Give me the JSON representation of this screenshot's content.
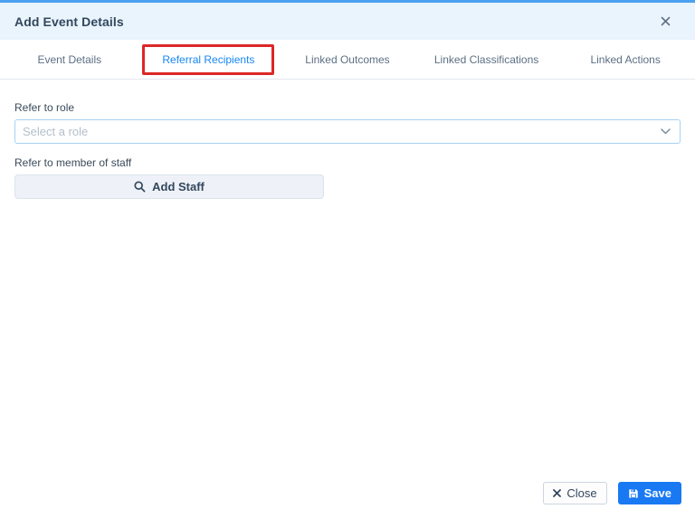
{
  "modal": {
    "title": "Add Event Details"
  },
  "tabs": [
    {
      "label": "Event Details",
      "active": false
    },
    {
      "label": "Referral Recipients",
      "active": true,
      "annotated": true,
      "annotation_color": "#dd2727"
    },
    {
      "label": "Linked Outcomes",
      "active": false
    },
    {
      "label": "Linked Classifications",
      "active": false
    },
    {
      "label": "Linked Actions",
      "active": false
    }
  ],
  "form": {
    "role_label": "Refer to role",
    "role_placeholder": "Select a role",
    "staff_label": "Refer to member of staff",
    "add_staff_label": "Add Staff"
  },
  "footer": {
    "close_label": "Close",
    "save_label": "Save"
  },
  "colors": {
    "accent_top": "#4ba1f1",
    "header_bg": "#e9f4fd",
    "active_tab": "#1787f4",
    "annotation_red": "#dd2727",
    "save_button": "#1979f3"
  }
}
